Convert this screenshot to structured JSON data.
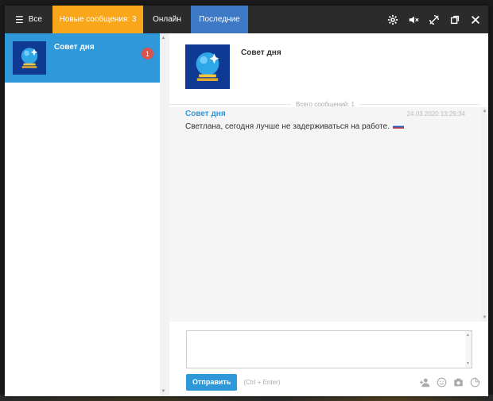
{
  "tabs": {
    "all_label": "Все",
    "new_label": "Новые сообщения: 3",
    "online_label": "Онлайн",
    "recent_label": "Последние"
  },
  "toolbar_icons": [
    "gear-icon",
    "mute-icon",
    "no-dnd-icon",
    "restore-icon",
    "close-icon"
  ],
  "contact": {
    "name": "Совет дня",
    "unread": "1"
  },
  "chat": {
    "title": "Совет дня",
    "total_messages": "Всего сообщений: 1",
    "messages": [
      {
        "author": "Совет дня",
        "time": "24.03.2020 13:29:34",
        "text": "Светлана, сегодня лучше не задерживаться на работе."
      }
    ]
  },
  "composer": {
    "placeholder": "",
    "send_label": "Отправить",
    "hint": "(Ctrl + Enter)"
  },
  "colors": {
    "accent": "#2f98d8",
    "new_tab": "#f9a61a",
    "recent_tab": "#3d79c4",
    "badge": "#d9534f"
  }
}
